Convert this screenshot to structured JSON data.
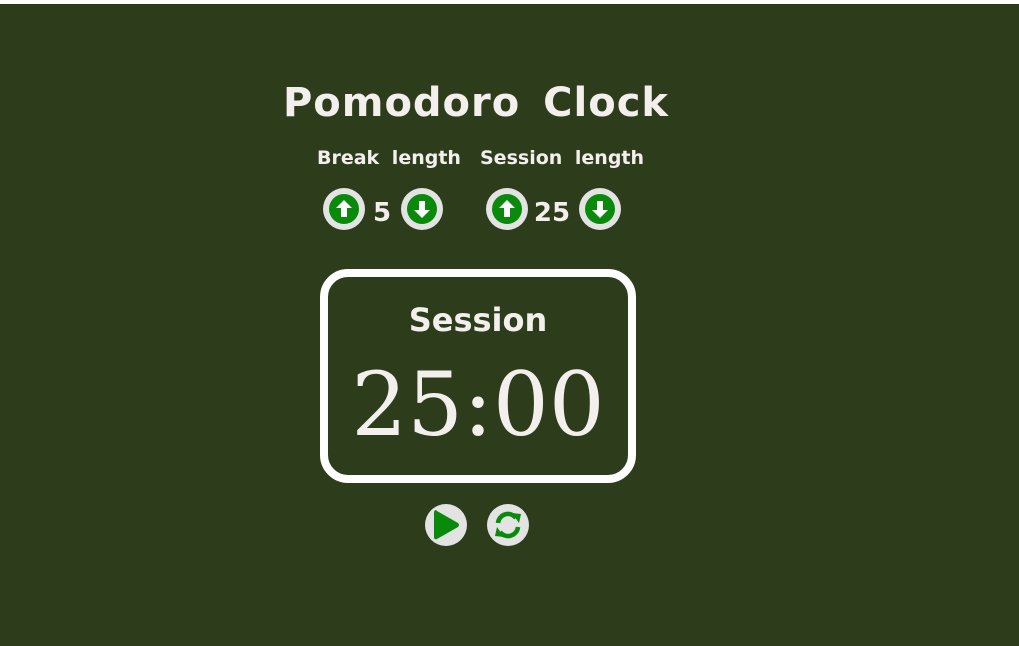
{
  "app": {
    "title": "Pomodoro Clock",
    "background_color": "#2d3d1c",
    "text_color": "#f3efec",
    "accent_color": "#0a8a0a"
  },
  "break": {
    "label": "Break length",
    "value": "5",
    "increment_icon": "arrow-up-circle-icon",
    "decrement_icon": "arrow-down-circle-icon"
  },
  "session": {
    "label": "Session length",
    "value": "25",
    "increment_icon": "arrow-up-circle-icon",
    "decrement_icon": "arrow-down-circle-icon"
  },
  "timer": {
    "label": "Session",
    "time": "25:00"
  },
  "controls": {
    "play_icon": "play-icon",
    "reset_icon": "refresh-icon"
  }
}
